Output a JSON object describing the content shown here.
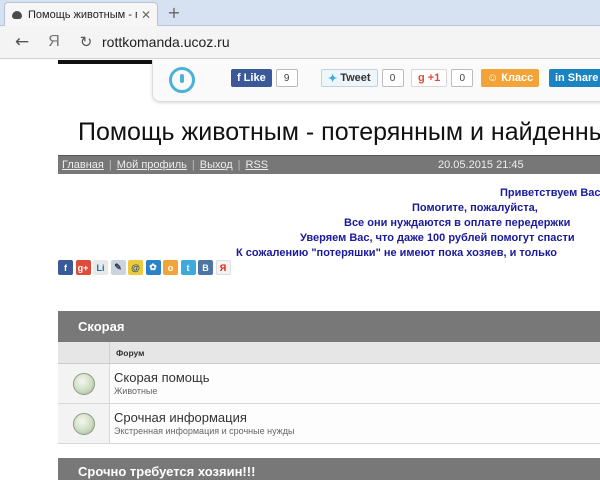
{
  "browser": {
    "tab_title": "Помощь животным - по",
    "tab_close": "✕",
    "new_tab": "+",
    "back": "←",
    "ya": "Я",
    "reload": "↻",
    "url": "rottkomanda.ucoz.ru"
  },
  "share_bar": {
    "fb_label": "Like",
    "fb_count": "9",
    "tw_label": "Tweet",
    "tw_count": "0",
    "gp_label": "+1",
    "gp_count": "0",
    "ok_label": "Класс",
    "li_label": "Share",
    "colors": {
      "fb": "#3b5998",
      "tw": "#3ea9dd",
      "gp": "#dd4b39",
      "ok": "#f2a438",
      "li": "#1a83c2"
    }
  },
  "site": {
    "title": "Помощь животным - потерянным и найденным"
  },
  "nav": {
    "home": "Главная",
    "profile": "Мой профиль",
    "logout": "Выход",
    "rss": "RSS",
    "sep": "|",
    "datetime": "20.05.2015 21:45"
  },
  "welcome": {
    "line1": "Приветствуем Вас",
    "line2": "Помогите, пожалуйста,",
    "line3": "Все они нуждаются в оплате передержки",
    "line4": "Уверяем Вас, что даже 100 рублей помогут спасти",
    "line5": "К сожалению \"потеряшки\" не имеют пока хозяев, и только"
  },
  "share_icons": {
    "fb": "f",
    "gp": "g+",
    "li": "Li",
    "bm": "✎",
    "mail": "@",
    "mr": "✿",
    "ok": "о",
    "tw": "t",
    "vk": "В",
    "ya": "Я"
  },
  "forum": {
    "category1": "Скорая",
    "col_forum": "Форум",
    "rows": [
      {
        "name": "Скорая помощь",
        "desc": "Животные"
      },
      {
        "name": "Срочная информация",
        "desc": "Экстренная информация и срочные нужды"
      }
    ],
    "category2": "Срочно требуется хозяин!!!"
  }
}
